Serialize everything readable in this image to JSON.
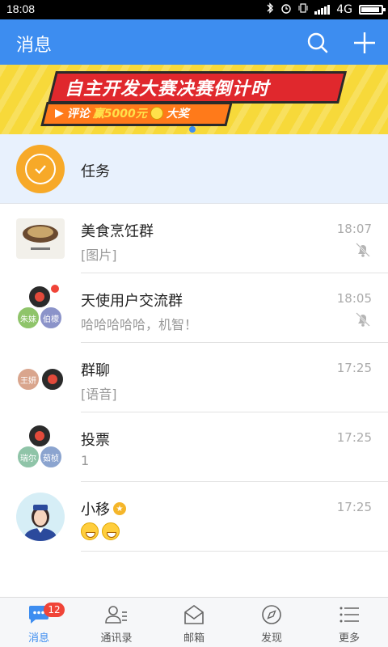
{
  "status_bar": {
    "time": "18:08",
    "network": "4G",
    "icons": [
      "bluetooth-icon",
      "alarm-icon",
      "vibrate-icon",
      "signal-icon",
      "battery-icon"
    ]
  },
  "header": {
    "title": "消息",
    "actions": [
      "search-icon",
      "plus-icon"
    ],
    "color": "#3d8df0"
  },
  "banner": {
    "headline": "自主开发大赛决赛倒计时",
    "subline_prefix": "评论",
    "subline_highlight": "赢5000元",
    "subline_suffix": "大奖"
  },
  "task": {
    "label": "任务",
    "color": "#f7a928"
  },
  "conversations": [
    {
      "name": "美食烹饪群",
      "preview": "[图片]",
      "time": "18:07",
      "muted": true
    },
    {
      "name": "天使用户交流群",
      "preview": "哈哈哈哈哈，机智！",
      "time": "18:05",
      "muted": true,
      "unread_dot": true,
      "members": [
        "朱妹",
        "伯檬"
      ]
    },
    {
      "name": "群聊",
      "preview": "[语音]",
      "time": "17:25",
      "muted": false,
      "members": [
        "王妍"
      ]
    },
    {
      "name": "投票",
      "preview": "1",
      "time": "17:25",
      "muted": false,
      "members": [
        "瑞尔",
        "茹桢"
      ]
    },
    {
      "name": "小移",
      "preview": "",
      "time": "17:25",
      "muted": false,
      "verified": true,
      "emoji_count": 2
    }
  ],
  "tabs": [
    {
      "label": "消息",
      "icon": "chat-bubble-icon",
      "badge": "12",
      "active": true
    },
    {
      "label": "通讯录",
      "icon": "contacts-icon"
    },
    {
      "label": "邮箱",
      "icon": "mail-icon"
    },
    {
      "label": "发现",
      "icon": "compass-icon"
    },
    {
      "label": "更多",
      "icon": "menu-list-icon"
    }
  ]
}
